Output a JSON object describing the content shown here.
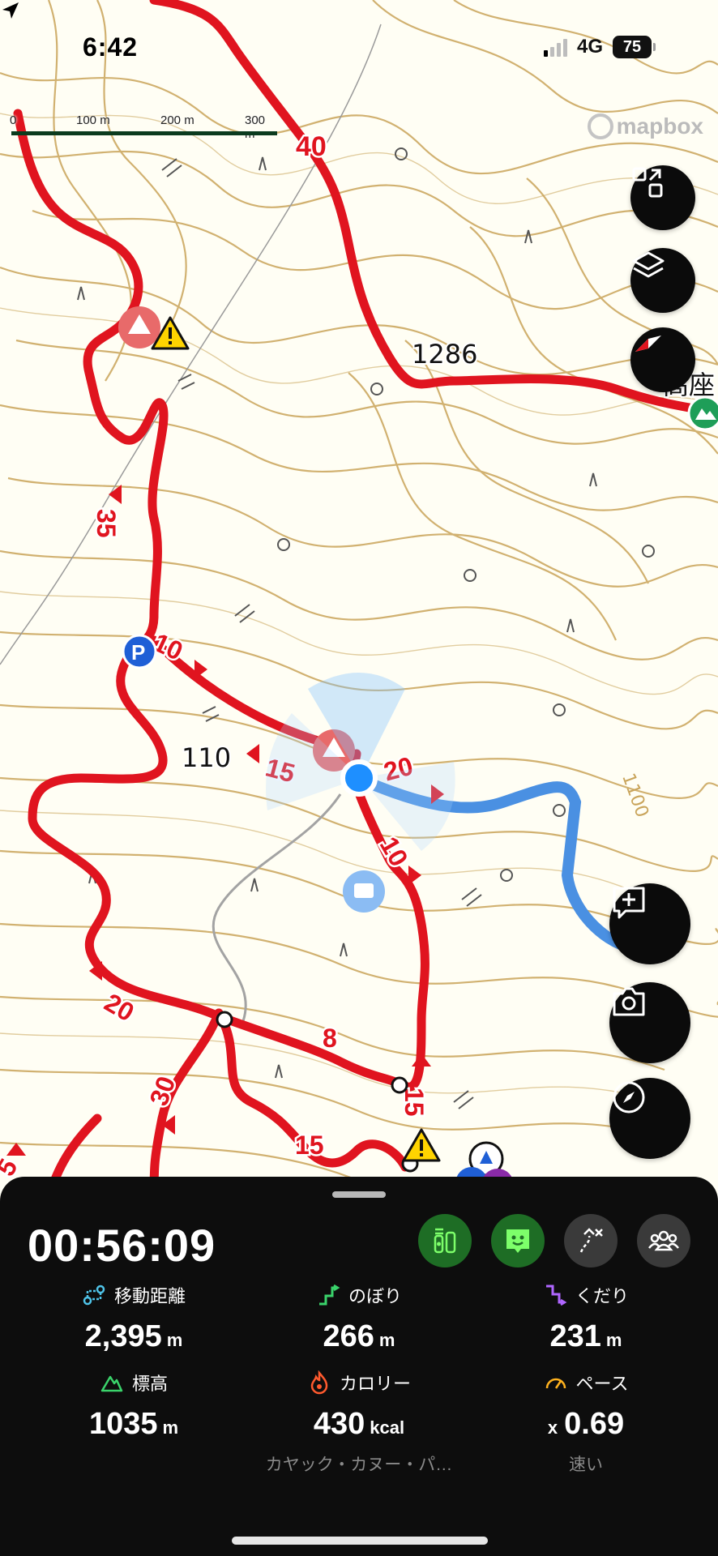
{
  "status_bar": {
    "time": "6:42",
    "network": "4G",
    "battery": "75"
  },
  "map": {
    "scale_labels": [
      "0",
      "100 m",
      "200 m",
      "300 m"
    ],
    "attribution": "mapbox",
    "elevations": [
      "1286",
      "1100",
      "110"
    ],
    "place_name": "高座",
    "route_times": [
      "40",
      "35",
      "10",
      "15",
      "20",
      "10",
      "20",
      "8",
      "30",
      "15",
      "15",
      "5"
    ],
    "colors": {
      "route": "#e0141f",
      "track": "#2e8ee8",
      "contour": "#c49a45",
      "button": "#0b0b0b"
    }
  },
  "map_controls": [
    "expand-icon",
    "layers-icon",
    "compass-mode-icon",
    "add-note-icon",
    "camera-icon",
    "compass-icon"
  ],
  "panel": {
    "elapsed": "00:56:09",
    "stats": {
      "distance": {
        "label": "移動距離",
        "value": "2,395",
        "unit": "m"
      },
      "ascent": {
        "label": "のぼり",
        "value": "266",
        "unit": "m"
      },
      "descent": {
        "label": "くだり",
        "value": "231",
        "unit": "m"
      },
      "elevation": {
        "label": "標高",
        "value": "1035",
        "unit": "m"
      },
      "calories": {
        "label": "カロリー",
        "value": "430",
        "unit": "kcal",
        "sub": "カヤック・カヌー・パ…"
      },
      "pace": {
        "label": "ペース",
        "prefix": "x",
        "value": "0.69",
        "sub": "速い"
      }
    }
  }
}
